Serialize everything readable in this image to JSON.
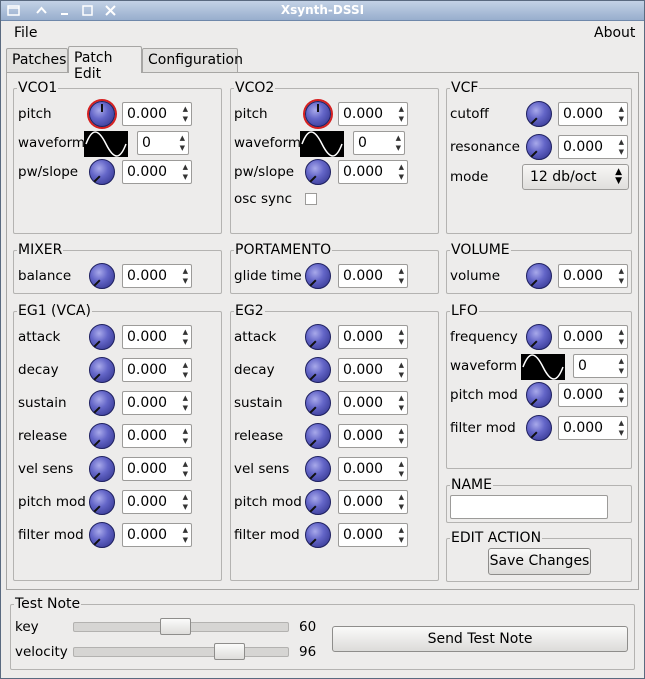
{
  "window": {
    "title": "Xsynth-DSSI"
  },
  "menu": {
    "file": "File",
    "about": "About"
  },
  "tabs": [
    "Patches",
    "Patch Edit",
    "Configuration"
  ],
  "vco1": {
    "title": "VCO1",
    "pitch_label": "pitch",
    "pitch": "0.000",
    "waveform_label": "waveform",
    "waveform": "0",
    "pw_label": "pw/slope",
    "pw": "0.000"
  },
  "vco2": {
    "title": "VCO2",
    "pitch_label": "pitch",
    "pitch": "0.000",
    "waveform_label": "waveform",
    "waveform": "0",
    "pw_label": "pw/slope",
    "pw": "0.000",
    "sync_label": "osc sync"
  },
  "vcf": {
    "title": "VCF",
    "cutoff_label": "cutoff",
    "cutoff": "0.000",
    "resonance_label": "resonance",
    "resonance": "0.000",
    "mode_label": "mode",
    "mode": "12 db/oct"
  },
  "mixer": {
    "title": "MIXER",
    "balance_label": "balance",
    "balance": "0.000"
  },
  "portamento": {
    "title": "PORTAMENTO",
    "glide_label": "glide time",
    "glide": "0.000"
  },
  "volume": {
    "title": "VOLUME",
    "volume_label": "volume",
    "volume": "0.000"
  },
  "eg1": {
    "title": "EG1 (VCA)",
    "rows": [
      {
        "label": "attack",
        "value": "0.000"
      },
      {
        "label": "decay",
        "value": "0.000"
      },
      {
        "label": "sustain",
        "value": "0.000"
      },
      {
        "label": "release",
        "value": "0.000"
      },
      {
        "label": "vel sens",
        "value": "0.000"
      },
      {
        "label": "pitch mod",
        "value": "0.000"
      },
      {
        "label": "filter mod",
        "value": "0.000"
      }
    ]
  },
  "eg2": {
    "title": "EG2",
    "rows": [
      {
        "label": "attack",
        "value": "0.000"
      },
      {
        "label": "decay",
        "value": "0.000"
      },
      {
        "label": "sustain",
        "value": "0.000"
      },
      {
        "label": "release",
        "value": "0.000"
      },
      {
        "label": "vel sens",
        "value": "0.000"
      },
      {
        "label": "pitch mod",
        "value": "0.000"
      },
      {
        "label": "filter mod",
        "value": "0.000"
      }
    ]
  },
  "lfo": {
    "title": "LFO",
    "frequency_label": "frequency",
    "frequency": "0.000",
    "waveform_label": "waveform",
    "waveform": "0",
    "pitchmod_label": "pitch mod",
    "pitchmod": "0.000",
    "filtermod_label": "filter mod",
    "filtermod": "0.000"
  },
  "name": {
    "title": "NAME",
    "value": ""
  },
  "edit_action": {
    "title": "EDIT ACTION",
    "save_label": "Save Changes"
  },
  "test_note": {
    "title": "Test Note",
    "key_label": "key",
    "key": "60",
    "key_fraction": 0.47,
    "velocity_label": "velocity",
    "velocity": "96",
    "velocity_fraction": 0.76,
    "send_label": "Send Test Note"
  },
  "icons": {
    "window_menu": "window-menu-icon",
    "shade": "shade-icon",
    "minimize": "minimize-icon",
    "maximize": "maximize-icon",
    "close": "close-icon",
    "wave": "sine-wave-icon"
  }
}
